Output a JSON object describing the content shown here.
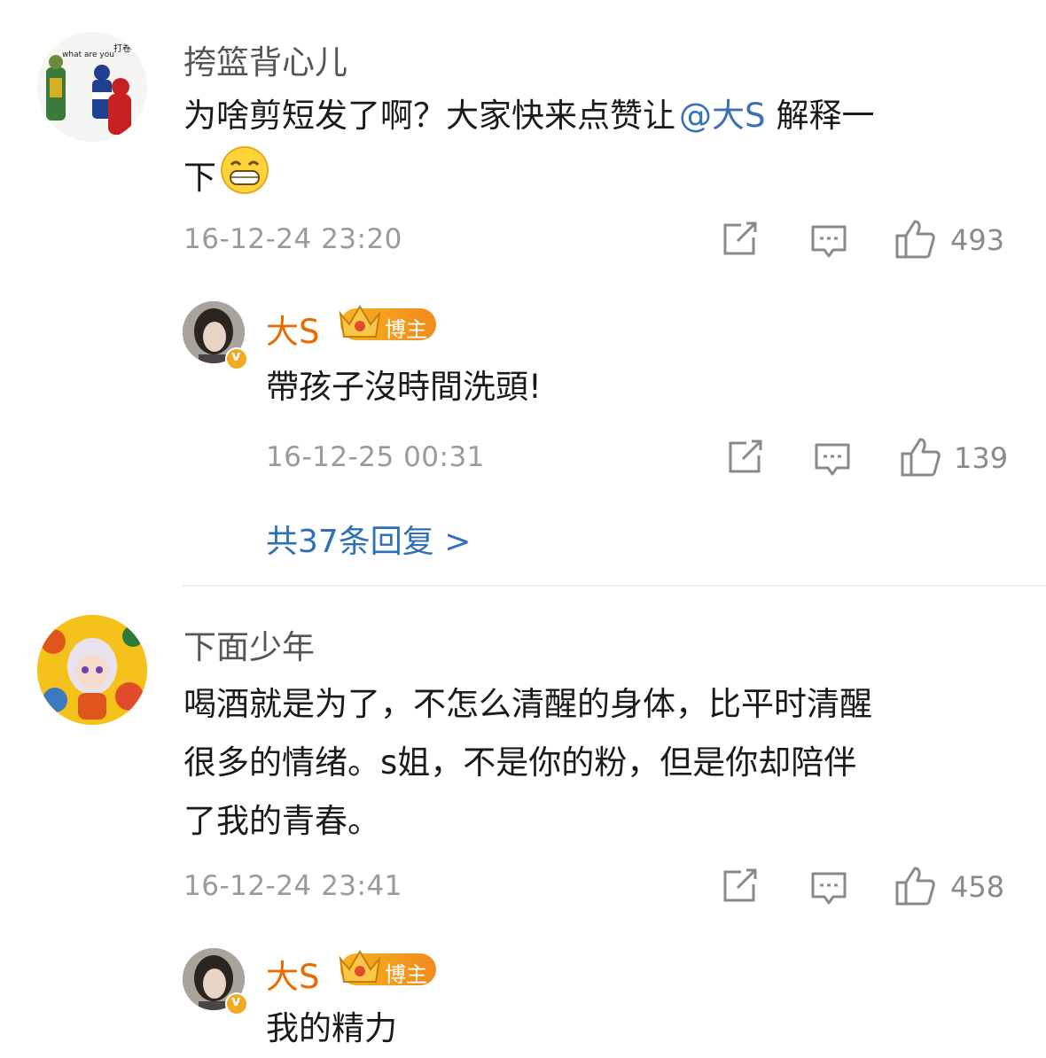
{
  "comments": [
    {
      "username": "挎篮背心儿",
      "avatar_text": "what are you 打卷",
      "text_before_mention": "为啥剪短发了啊？大家快来点赞让",
      "mention": "@大S",
      "text_after_mention": "解释一",
      "text_line2": "下",
      "time": "16-12-24 23:20",
      "likes": "493"
    },
    {
      "username": "下面少年",
      "text_line1": "喝酒就是为了，不怎么清醒的身体，比平时清醒",
      "text_line2": "很多的情绪。s姐，不是你的粉，但是你却陪伴",
      "text_line3": "了我的青春。",
      "time": "16-12-24 23:41",
      "likes": "458"
    }
  ],
  "replies": [
    {
      "name": "大S",
      "badge": "博主",
      "text": "帶孩子沒時間洗頭!",
      "time": "16-12-25 00:31",
      "likes": "139",
      "more_replies": "共37条回复 >"
    },
    {
      "name": "大S",
      "badge": "博主",
      "text_partial": "我的精力"
    }
  ],
  "icons": [
    "share-icon",
    "comment-icon",
    "like-icon"
  ],
  "colors": {
    "mention": "#3b6fb6",
    "reply_name": "#e86a00",
    "more_link": "#2f6fb7",
    "badge": "#f3a921"
  }
}
